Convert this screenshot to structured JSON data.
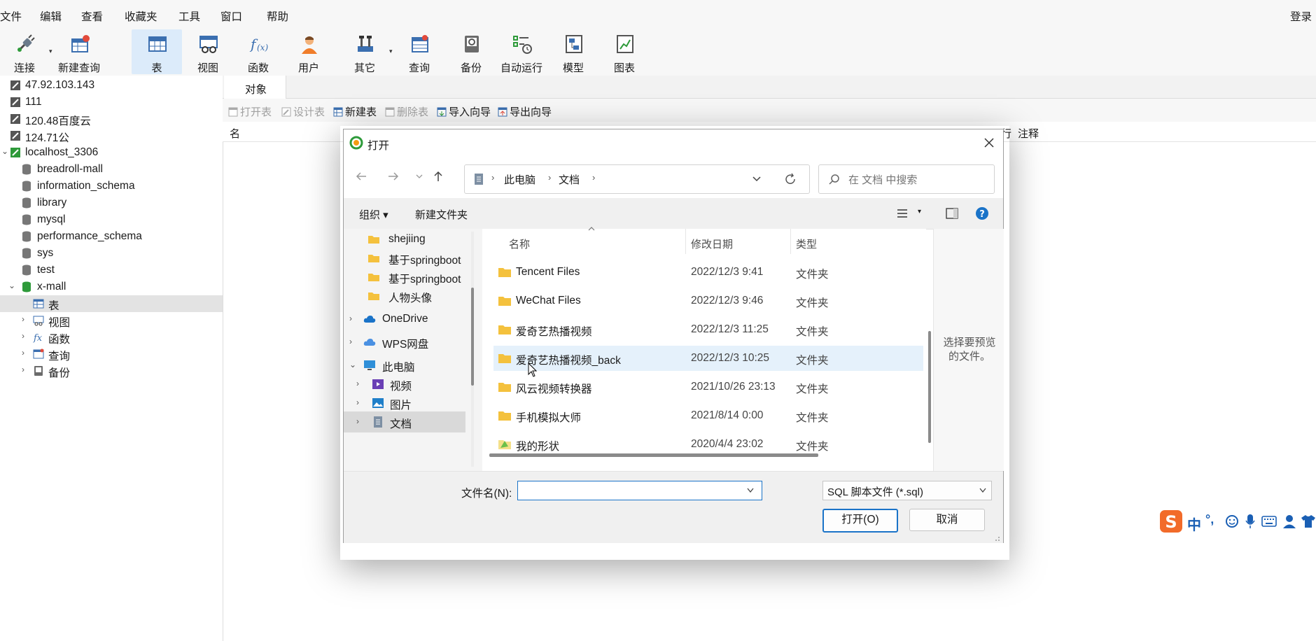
{
  "menu": {
    "items": [
      "文件",
      "编辑",
      "查看",
      "收藏夹",
      "工具",
      "窗口",
      "帮助"
    ],
    "login": "登录"
  },
  "toolbar": {
    "buttons": [
      {
        "label": "连接",
        "icon": "connection-plug-icon"
      },
      {
        "label": "新建查询",
        "icon": "new-query-icon"
      },
      {
        "label": "表",
        "icon": "table-icon",
        "active": true
      },
      {
        "label": "视图",
        "icon": "view-icon"
      },
      {
        "label": "函数",
        "icon": "function-icon"
      },
      {
        "label": "用户",
        "icon": "user-icon"
      },
      {
        "label": "其它",
        "icon": "tools-icon"
      },
      {
        "label": "查询",
        "icon": "query-icon"
      },
      {
        "label": "备份",
        "icon": "backup-icon"
      },
      {
        "label": "自动运行",
        "icon": "schedule-icon"
      },
      {
        "label": "模型",
        "icon": "model-icon"
      },
      {
        "label": "图表",
        "icon": "chart-icon"
      }
    ]
  },
  "tree": {
    "connections": [
      "47.92.103.143",
      "111",
      "120.48百度云",
      "124.71公"
    ],
    "local": "localhost_3306",
    "databases": [
      "breadroll-mall",
      "information_schema",
      "library",
      "mysql",
      "performance_schema",
      "sys",
      "test"
    ],
    "open_db": "x-mall",
    "open_db_children": [
      "表",
      "视图",
      "函数",
      "查询",
      "备份"
    ]
  },
  "objects": {
    "tab": "对象",
    "tools": {
      "open": "打开表",
      "design": "设计表",
      "new": "新建表",
      "delete": "删除表",
      "import": "导入向导",
      "export": "导出向导"
    },
    "columns": {
      "name": "名",
      "rows": "行",
      "comment": "注释"
    }
  },
  "dialog": {
    "title": "打开",
    "breadcrumb": [
      "此电脑",
      "文档"
    ],
    "search_placeholder": "在 文档 中搜索",
    "organize": "组织 ▾",
    "new_folder": "新建文件夹",
    "nav": [
      {
        "label": "shejiing",
        "kind": "folder"
      },
      {
        "label": "基于springboot",
        "kind": "folder"
      },
      {
        "label": "基于springboot",
        "kind": "folder"
      },
      {
        "label": "人物头像",
        "kind": "folder"
      },
      {
        "label": "OneDrive",
        "kind": "onedrive"
      },
      {
        "label": "WPS网盘",
        "kind": "wps"
      },
      {
        "label": "此电脑",
        "kind": "pc"
      },
      {
        "label": "视频",
        "kind": "video"
      },
      {
        "label": "图片",
        "kind": "picture"
      },
      {
        "label": "文档",
        "kind": "document"
      }
    ],
    "columns": {
      "name": "名称",
      "date": "修改日期",
      "type": "类型"
    },
    "files": [
      {
        "name": "Tencent Files",
        "date": "2022/12/3 9:41",
        "type": "文件夹"
      },
      {
        "name": "WeChat Files",
        "date": "2022/12/3 9:46",
        "type": "文件夹"
      },
      {
        "name": "爱奇艺热播视频",
        "date": "2022/12/3 11:25",
        "type": "文件夹"
      },
      {
        "name": "爱奇艺热播视频_back",
        "date": "2022/12/3 10:25",
        "type": "文件夹"
      },
      {
        "name": "风云视频转换器",
        "date": "2021/10/26 23:13",
        "type": "文件夹"
      },
      {
        "name": "手机模拟大师",
        "date": "2021/8/14 0:00",
        "type": "文件夹"
      },
      {
        "name": "我的形状",
        "date": "2020/4/4 23:02",
        "type": "文件夹"
      }
    ],
    "preview_text": "选择要预览的文件。",
    "filename_label": "文件名(N):",
    "filename_value": "",
    "filetype": "SQL 脚本文件 (*.sql)",
    "open_button": "打开(O)",
    "cancel_button": "取消"
  },
  "ime": {
    "mode": "中",
    "punct": "°,"
  }
}
